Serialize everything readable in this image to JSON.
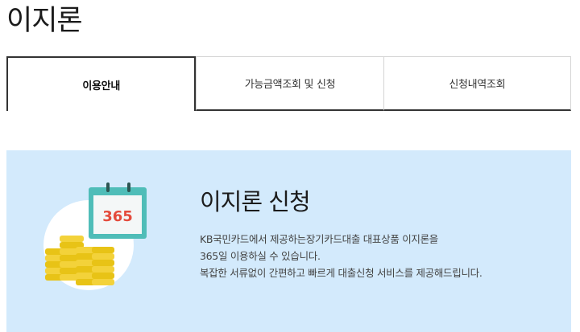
{
  "page": {
    "title": "이지론"
  },
  "tabs": [
    {
      "label": "이용안내",
      "active": true
    },
    {
      "label": "가능금액조회 및 신청",
      "active": false
    },
    {
      "label": "신청내역조회",
      "active": false
    }
  ],
  "banner": {
    "title": "이지론 신청",
    "calendar_number": "365",
    "lines": [
      "KB국민카드에서 제공하는장기카드대출 대표상품 이지론을",
      "365일 이용하실 수 있습니다.",
      "복잡한 서류없이 간편하고 빠르게 대출신청 서비스를 제공해드립니다."
    ],
    "colors": {
      "background": "#d3eafc",
      "calendar": "#4fbdb8",
      "coin": "#f2cf1c",
      "calendar_number": "#e44b3c"
    },
    "icons": [
      "calendar-icon",
      "coin-stack-icon"
    ]
  }
}
